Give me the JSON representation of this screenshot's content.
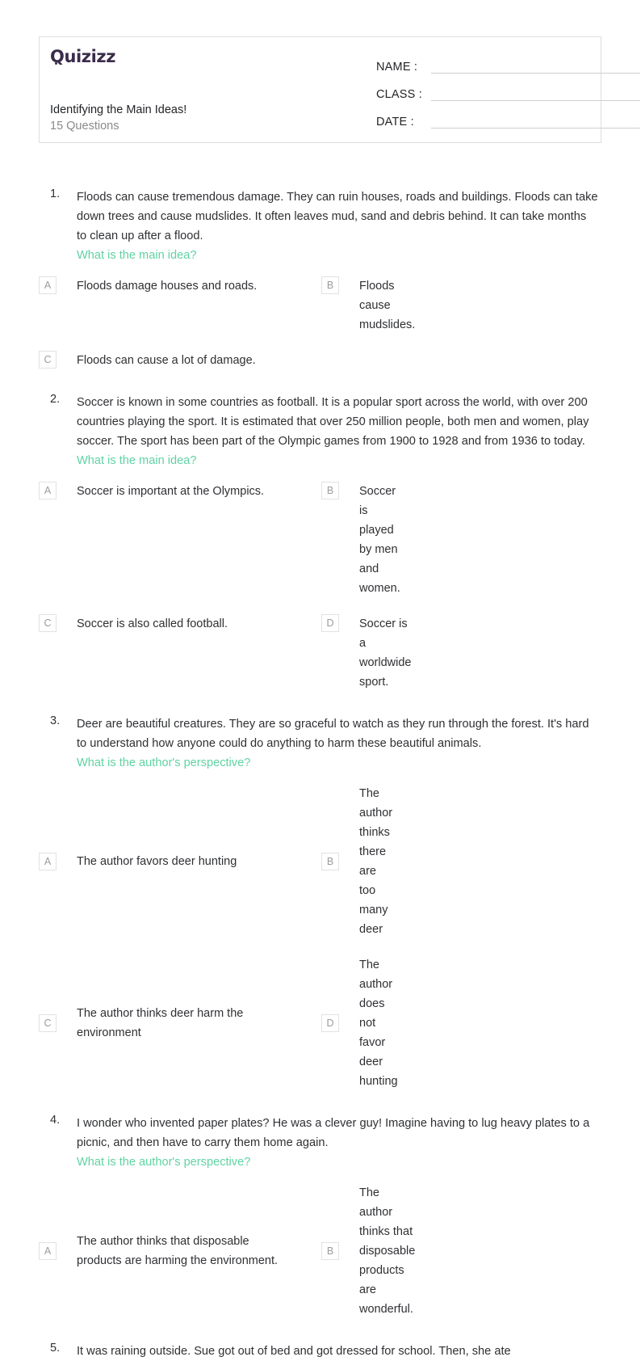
{
  "header": {
    "logo_text": "Quizizz",
    "logo_color": "#3a2c4a",
    "title": "Identifying the Main Ideas!",
    "question_count": "15 Questions",
    "fields": [
      {
        "label": "NAME :",
        "value": ""
      },
      {
        "label": "CLASS :",
        "value": ""
      },
      {
        "label": "DATE  :",
        "value": ""
      }
    ]
  },
  "theme": {
    "prompt_green": "#5fd3a2",
    "text_dark": "#2f3033",
    "muted_gray": "#8a8a8a",
    "border_gray": "#dedede"
  },
  "questions": [
    {
      "number": "1.",
      "passage": "Floods can cause tremendous damage. They can ruin houses, roads and buildings. Floods can take down trees and cause mudslides. It often leaves mud, sand and debris behind. It can take months to clean up after a flood.",
      "prompt": "What is the main idea?",
      "options": [
        {
          "letter": "A",
          "text": "Floods damage houses and roads."
        },
        {
          "letter": "B",
          "text": "Floods cause mudslides."
        },
        {
          "letter": "C",
          "text": "Floods can cause a lot of damage."
        }
      ]
    },
    {
      "number": "2.",
      "passage": "Soccer is known in some countries as football. It is a popular sport across the world, with over 200 countries playing the sport. It is estimated that over 250 million people, both men and women, play soccer. The sport has been part of the Olympic games from 1900 to 1928 and from 1936 to today.",
      "prompt": " What is the main idea?",
      "options": [
        {
          "letter": "A",
          "text": "Soccer is important at the Olympics."
        },
        {
          "letter": "B",
          "text": "Soccer is played by men and women."
        },
        {
          "letter": "C",
          "text": "Soccer is also called football."
        },
        {
          "letter": "D",
          "text": "Soccer is a worldwide sport."
        }
      ]
    },
    {
      "number": "3.",
      "passage": "Deer are beautiful creatures. They are so graceful to watch as they run through the forest. It's hard to understand how anyone could do anything to harm these beautiful animals.",
      "prompt": "What is the author's perspective?",
      "options": [
        {
          "letter": "A",
          "text": "The author favors deer hunting"
        },
        {
          "letter": "B",
          "text": "The author thinks there are too many deer"
        },
        {
          "letter": "C",
          "text": "The author thinks deer harm the environment"
        },
        {
          "letter": "D",
          "text": "The author does not favor deer hunting"
        }
      ]
    },
    {
      "number": "4.",
      "passage": "I wonder who invented paper plates? He was a clever guy! Imagine having to lug heavy plates to a picnic, and then have to carry them home again.",
      "prompt": "What is the author's perspective?",
      "options": [
        {
          "letter": "A",
          "text": "The author thinks that disposable products are harming the environment."
        },
        {
          "letter": "B",
          "text": "The author thinks that disposable products are wonderful."
        }
      ]
    },
    {
      "number": "5.",
      "passage": "It was raining outside. Sue got out of bed and got dressed for school. Then, she ate",
      "prompt": "",
      "options": []
    }
  ]
}
